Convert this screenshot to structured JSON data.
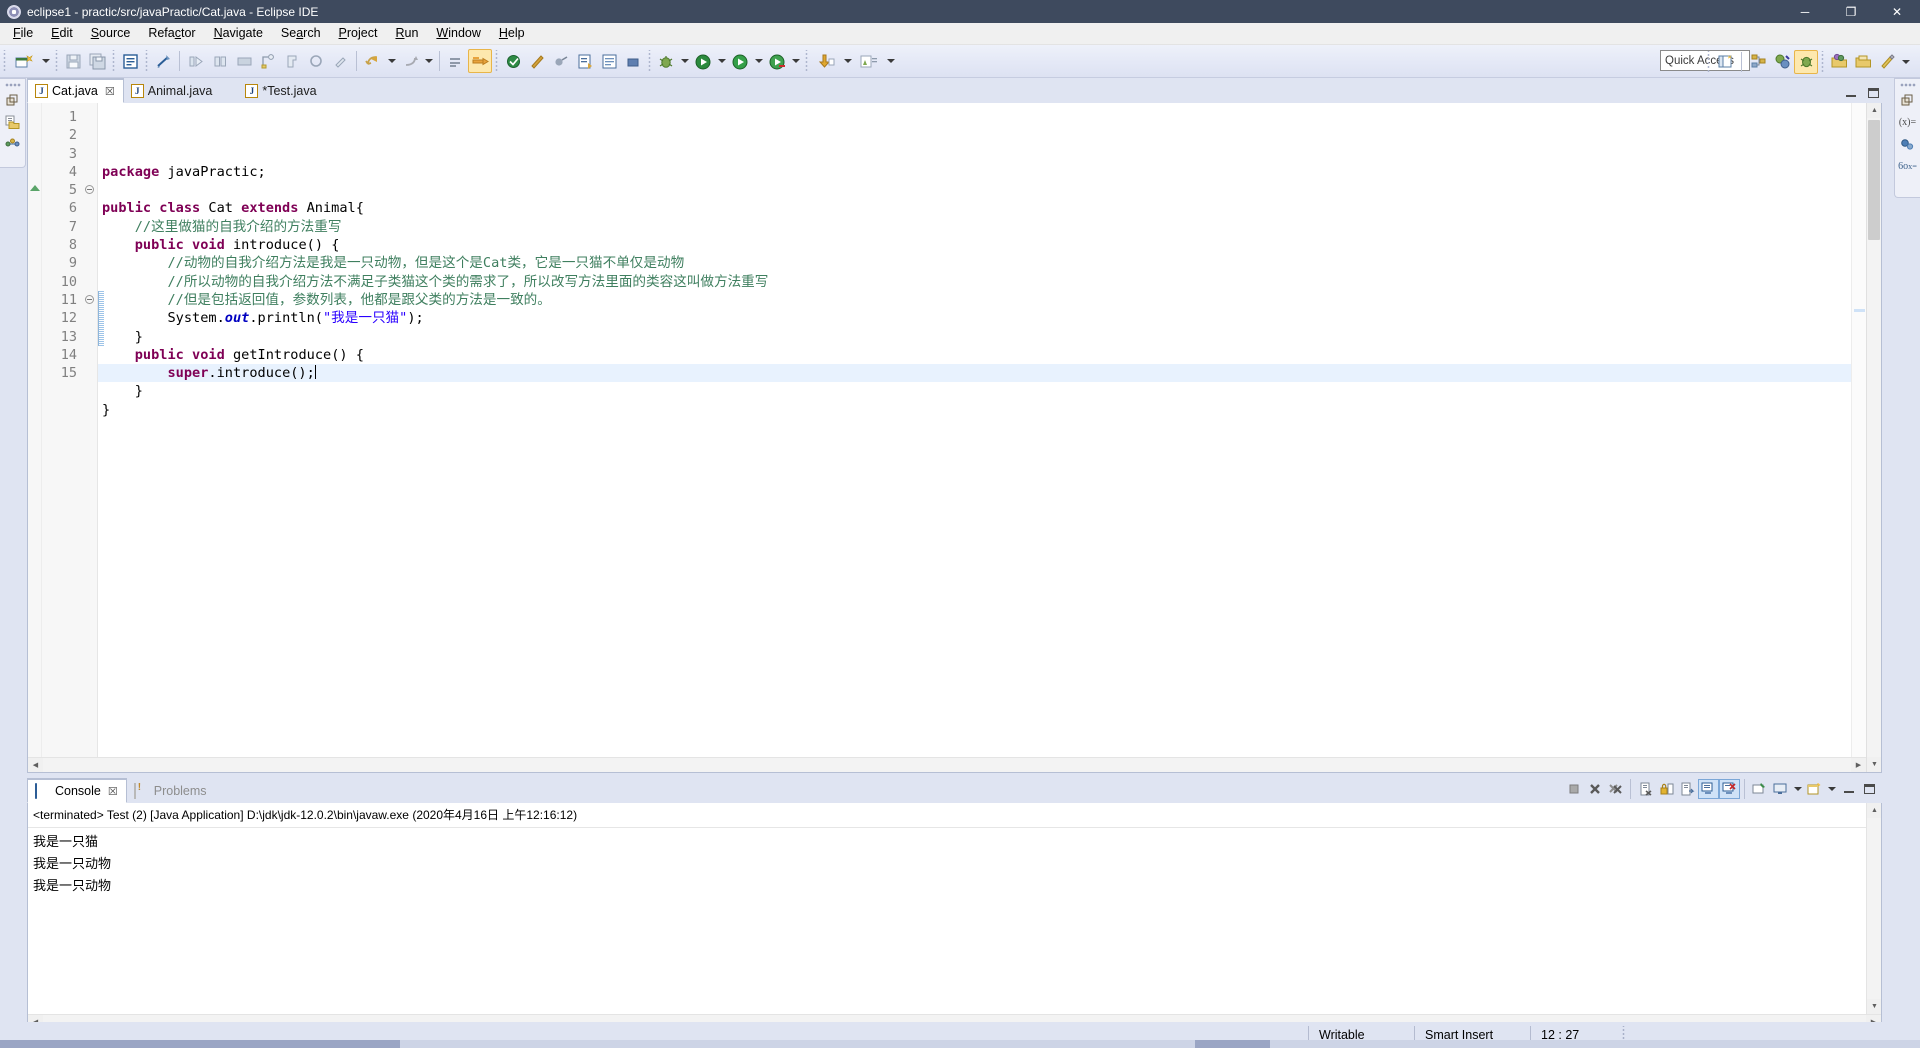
{
  "window": {
    "title": "eclipse1 - practic/src/javaPractic/Cat.java - Eclipse IDE",
    "app_icon": "eclipse-gear-icon",
    "buttons": {
      "minimize": "─",
      "maximize": "❐",
      "close": "✕"
    }
  },
  "menu": {
    "items": [
      {
        "label": "File"
      },
      {
        "label": "Edit"
      },
      {
        "label": "Source"
      },
      {
        "label": "Refactor"
      },
      {
        "label": "Navigate"
      },
      {
        "label": "Search"
      },
      {
        "label": "Project"
      },
      {
        "label": "Run"
      },
      {
        "label": "Window"
      },
      {
        "label": "Help"
      }
    ]
  },
  "toolbar": {
    "quick_access_placeholder": "Quick Access",
    "quick_access_value": "",
    "icons": [
      "new-wizard-icon",
      "new-wizard-dropdown-icon",
      "save-icon",
      "save-all-icon",
      "new-java-class-icon",
      "link-with-editor-icon",
      "next-annotation-icon",
      "previous-annotation-icon",
      "toggle-mark-occurrences-icon",
      "new-java-package-icon",
      "open-type-icon",
      "search-icon",
      "last-edit-location-icon",
      "back-icon",
      "back-dropdown-icon",
      "forward-icon",
      "forward-dropdown-icon",
      "skip-all-breakpoints-icon",
      "build-all-icon",
      "toggle-breakpoint-icon",
      "external-tools-icon",
      "open-task-icon",
      "debug-icon",
      "debug-dropdown-icon",
      "run-icon",
      "run-dropdown-icon",
      "coverage-icon",
      "coverage-dropdown-icon",
      "java-export-icon",
      "java-export-dropdown-icon",
      "profile-icon"
    ],
    "perspective_icons": [
      "open-perspective-icon",
      "java-perspective-icon",
      "java-browsing-icon",
      "debug-perspective-icon",
      "open-resource-icon",
      "open-folder-icon",
      "customize-icon",
      "perspective-dropdown-icon"
    ]
  },
  "left_stack": {
    "icons": [
      "restore-icon",
      "package-explorer-icon",
      "junit-icon"
    ]
  },
  "right_stack": {
    "icons": [
      "restore-icon",
      "variables-icon",
      "breakpoints-icon",
      "expressions-icon"
    ]
  },
  "editor": {
    "tabs": [
      {
        "label": "Cat.java",
        "active": true,
        "dirty": false,
        "icon": "java-file-icon",
        "close": "☒"
      },
      {
        "label": "Animal.java",
        "active": false,
        "dirty": false,
        "icon": "java-file-icon"
      },
      {
        "label": "*Test.java",
        "active": false,
        "dirty": true,
        "icon": "java-file-icon"
      }
    ],
    "minimize_label": "Minimize",
    "maximize_label": "Maximize",
    "line_numbers": [
      "1",
      "2",
      "3",
      "4",
      "5",
      "6",
      "7",
      "8",
      "9",
      "10",
      "11",
      "12",
      "13",
      "14",
      "15"
    ],
    "folding_rows": [
      5,
      11
    ],
    "changebar_rows": [
      11,
      12,
      13
    ],
    "highlight_row": 12,
    "code_lines": [
      {
        "n": 1,
        "tokens": [
          {
            "t": "kw",
            "v": "package"
          },
          {
            "t": "plain",
            "v": " javaPractic;"
          }
        ]
      },
      {
        "n": 2,
        "tokens": []
      },
      {
        "n": 3,
        "tokens": [
          {
            "t": "kw",
            "v": "public"
          },
          {
            "t": "plain",
            "v": " "
          },
          {
            "t": "kw",
            "v": "class"
          },
          {
            "t": "plain",
            "v": " Cat "
          },
          {
            "t": "kw",
            "v": "extends"
          },
          {
            "t": "plain",
            "v": " Animal{"
          }
        ]
      },
      {
        "n": 4,
        "tokens": [
          {
            "t": "cmt",
            "v": "    //这里做猫的自我介绍的方法重写"
          }
        ]
      },
      {
        "n": 5,
        "tokens": [
          {
            "t": "plain",
            "v": "    "
          },
          {
            "t": "kw",
            "v": "public"
          },
          {
            "t": "plain",
            "v": " "
          },
          {
            "t": "kw",
            "v": "void"
          },
          {
            "t": "plain",
            "v": " introduce() {"
          }
        ]
      },
      {
        "n": 6,
        "tokens": [
          {
            "t": "cmt",
            "v": "        //动物的自我介绍方法是我是一只动物，但是这个是Cat类，它是一只猫不单仅是动物"
          }
        ]
      },
      {
        "n": 7,
        "tokens": [
          {
            "t": "cmt",
            "v": "        //所以动物的自我介绍方法不满足子类猫这个类的需求了，所以改写方法里面的类容这叫做方法重写"
          }
        ]
      },
      {
        "n": 8,
        "tokens": [
          {
            "t": "cmt",
            "v": "        //但是包括返回值，参数列表，他都是跟父类的方法是一致的。"
          }
        ]
      },
      {
        "n": 9,
        "tokens": [
          {
            "t": "plain",
            "v": "        System."
          },
          {
            "t": "fld",
            "v": "out"
          },
          {
            "t": "plain",
            "v": ".println("
          },
          {
            "t": "str",
            "v": "\"我是一只猫\""
          },
          {
            "t": "plain",
            "v": ");"
          }
        ]
      },
      {
        "n": 10,
        "tokens": [
          {
            "t": "plain",
            "v": "    }"
          }
        ]
      },
      {
        "n": 11,
        "tokens": [
          {
            "t": "plain",
            "v": "    "
          },
          {
            "t": "kw",
            "v": "public"
          },
          {
            "t": "plain",
            "v": " "
          },
          {
            "t": "kw",
            "v": "void"
          },
          {
            "t": "plain",
            "v": " getIntroduce() {"
          }
        ]
      },
      {
        "n": 12,
        "tokens": [
          {
            "t": "plain",
            "v": "        "
          },
          {
            "t": "kw",
            "v": "super"
          },
          {
            "t": "plain",
            "v": ".introduce();"
          }
        ],
        "caret": true
      },
      {
        "n": 13,
        "tokens": [
          {
            "t": "plain",
            "v": "    }"
          }
        ]
      },
      {
        "n": 14,
        "tokens": [
          {
            "t": "plain",
            "v": "}"
          }
        ]
      },
      {
        "n": 15,
        "tokens": []
      }
    ]
  },
  "console": {
    "tabs": [
      {
        "label": "Console",
        "active": true,
        "icon": "console-monitor-icon",
        "close": "☒"
      },
      {
        "label": "Problems",
        "active": false,
        "icon": "problems-warning-icon"
      }
    ],
    "launch_header": "<terminated> Test (2) [Java Application] D:\\jdk\\jdk-12.0.2\\bin\\javaw.exe (2020年4月16日 上午12:16:12)",
    "output_lines": [
      "我是一只猫",
      "我是一只动物",
      "我是一只动物"
    ],
    "toolbar_icons": [
      "terminate-icon",
      "remove-launch-icon",
      "remove-all-terminated-icon",
      "clear-console-icon",
      "scroll-lock-icon",
      "word-wrap-icon",
      "show-console-on-output-icon",
      "show-console-on-error-icon",
      "pin-console-icon",
      "display-selected-console-icon",
      "display-selected-console-dropdown-icon",
      "open-console-icon",
      "open-console-dropdown-icon",
      "minimize-icon",
      "maximize-icon"
    ]
  },
  "statusbar": {
    "writable": "Writable",
    "insert_mode": "Smart Insert",
    "cursor_position": "12 : 27"
  },
  "colors": {
    "titlebar_bg": "#3e4a5e",
    "toolbar_bg": "#e4e8f6",
    "panel_bg": "#dfe4f2",
    "editor_bg": "#ffffff",
    "keyword": "#7f0055",
    "comment": "#3f7f5f",
    "string": "#2a00ff",
    "field": "#0000c0",
    "line_number": "#808080",
    "highlight_line": "#e8f2fe",
    "accent": "#cfe2f7"
  }
}
